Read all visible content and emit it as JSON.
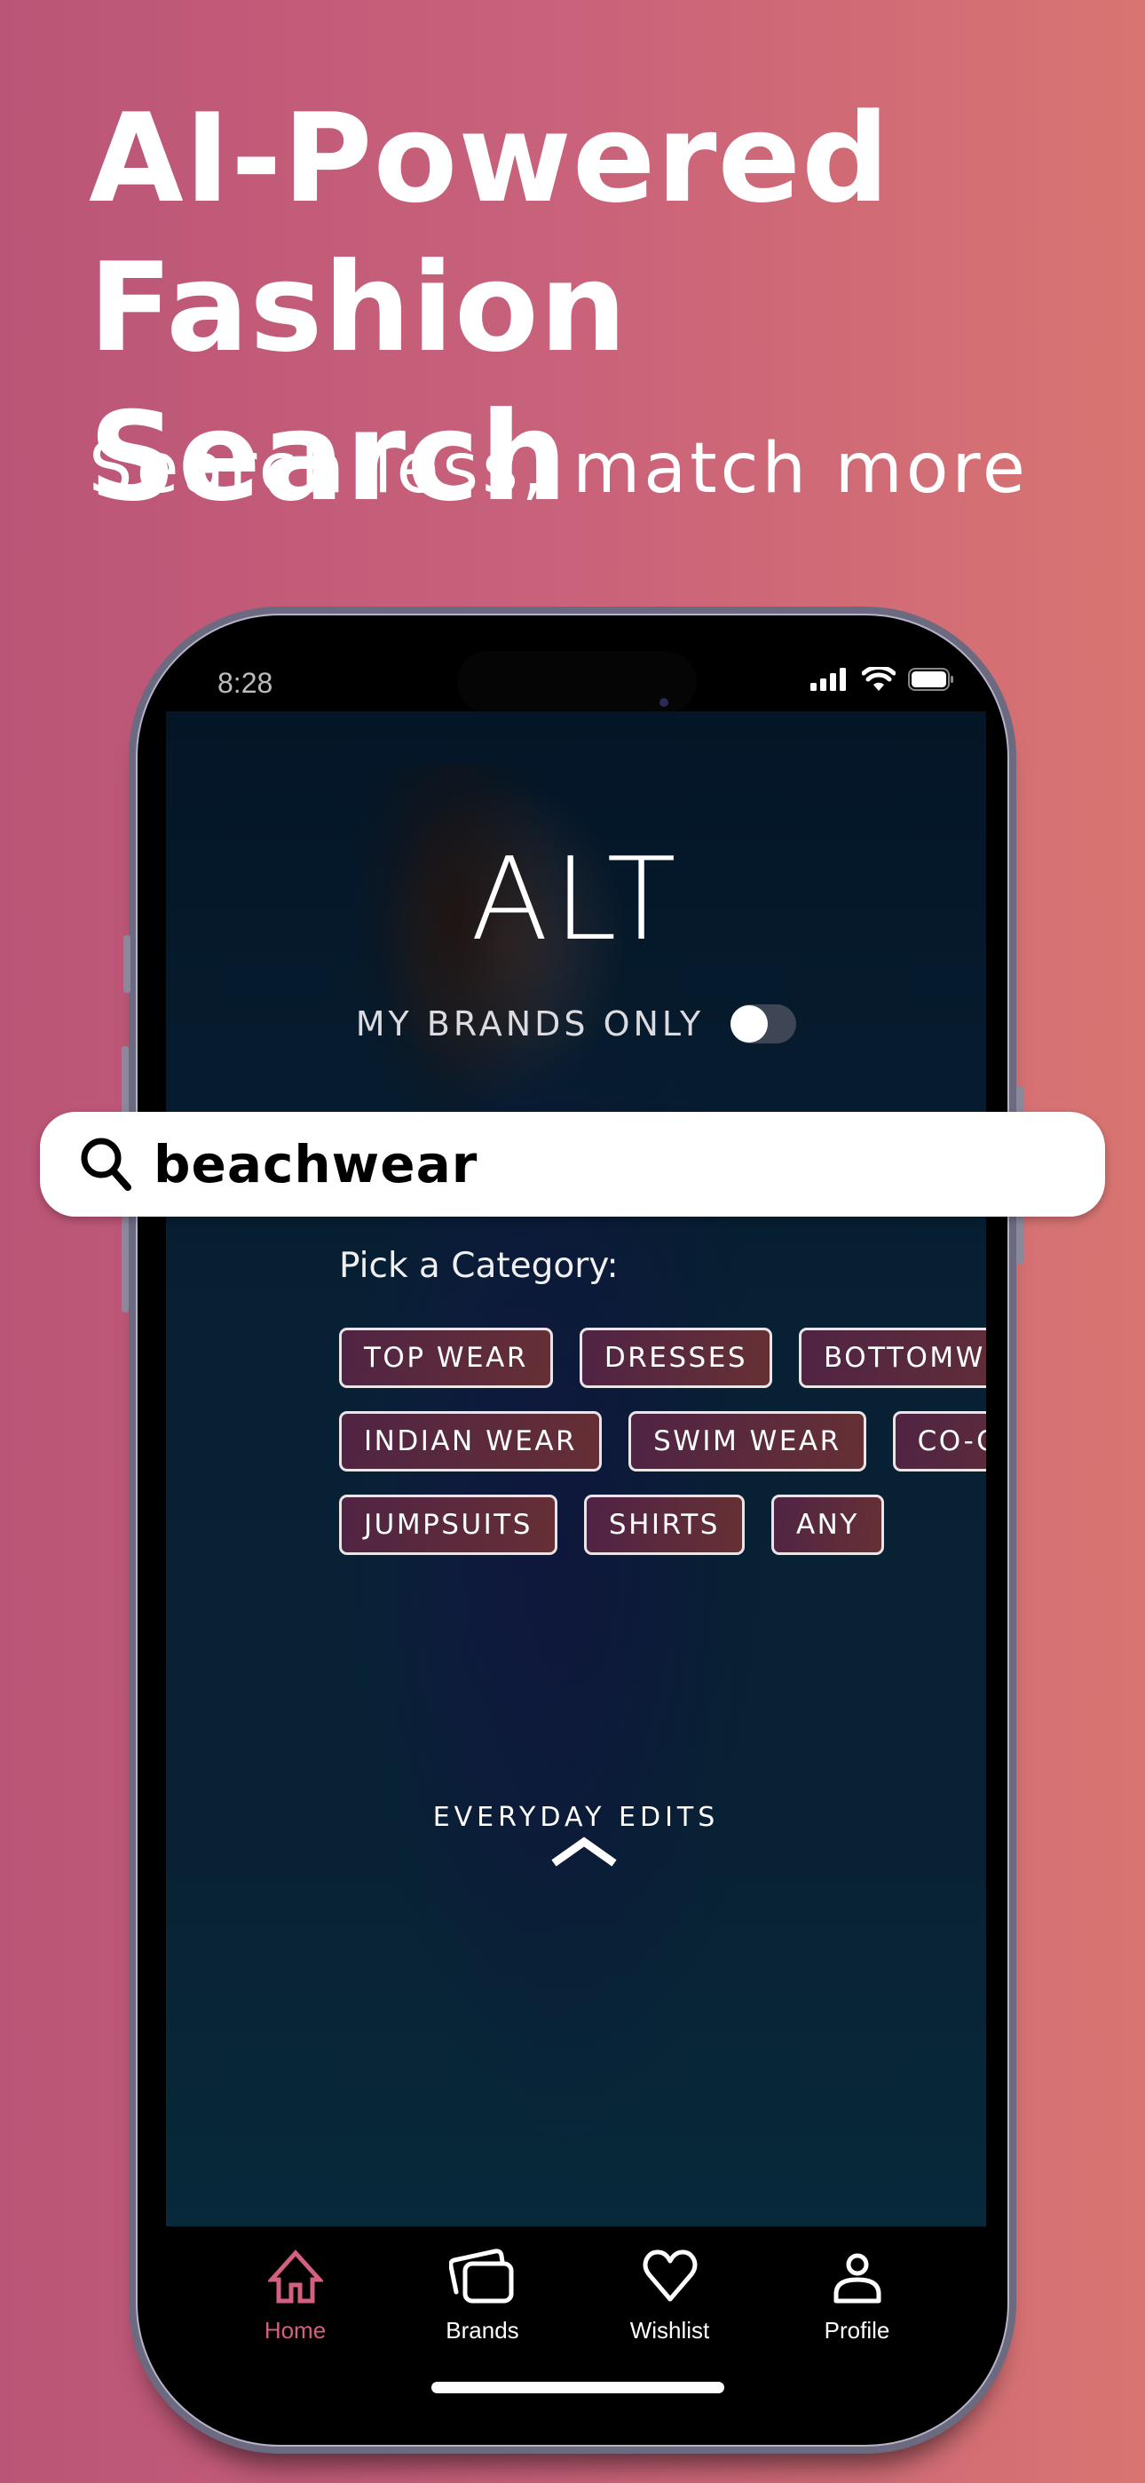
{
  "promo": {
    "headline_line1": "AI-Powered",
    "headline_line2": "Fashion Search",
    "subheadline": "Search less, match more",
    "background_gradient": [
      "#bb5577",
      "#d87572"
    ]
  },
  "status_bar": {
    "time": "8:28",
    "icons": [
      "cellular-signal-icon",
      "wifi-icon",
      "battery-icon"
    ]
  },
  "app": {
    "logo": "ALT",
    "my_brands_only": {
      "label": "MY BRANDS ONLY",
      "enabled": false
    },
    "search": {
      "value": "beachwear",
      "icon": "search-icon"
    },
    "category_prompt": "Pick a Category:",
    "categories": [
      [
        "TOP WEAR",
        "DRESSES",
        "BOTTOMWEAR"
      ],
      [
        "INDIAN WEAR",
        "SWIM WEAR",
        "CO-ORDS"
      ],
      [
        "JUMPSUITS",
        "SHIRTS",
        "ANY"
      ]
    ],
    "everyday_edits": "EVERYDAY EDITS",
    "accent_color": "#d2607e"
  },
  "tabbar": {
    "tabs": [
      {
        "label": "Home",
        "icon": "home-icon",
        "active": true
      },
      {
        "label": "Brands",
        "icon": "brands-icon",
        "active": false
      },
      {
        "label": "Wishlist",
        "icon": "heart-icon",
        "active": false
      },
      {
        "label": "Profile",
        "icon": "profile-icon",
        "active": false
      }
    ]
  }
}
